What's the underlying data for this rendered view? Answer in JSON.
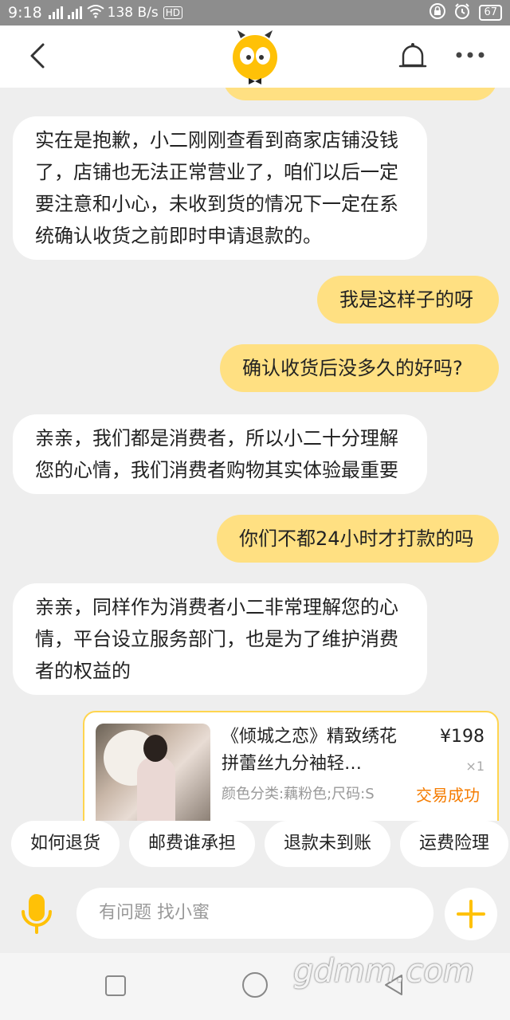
{
  "status_bar": {
    "time": "9:18",
    "net_type_1": "4G",
    "net_type_2": "2G",
    "speed": "138 B/s",
    "hd": "HD",
    "battery": "67"
  },
  "header": {
    "back_icon": "chevron-left-icon",
    "bell_icon": "bell-icon",
    "more_icon": "more-dots-icon",
    "brand_color": "#ffc107"
  },
  "messages": [
    {
      "side": "left",
      "text_lines": [
        "实在是抱歉，小二刚刚查看到商家店铺没钱",
        "了，店铺也无法正常营业了，咱们以后一定",
        "要注意和小心，未收到货的情况下一定在系",
        "统确认收货之前即时申请退款的。"
      ]
    },
    {
      "side": "right",
      "text_lines": [
        "我是这样子的呀"
      ]
    },
    {
      "side": "right",
      "text_lines": [
        "确认收货后没多久的好吗?"
      ]
    },
    {
      "side": "left",
      "text_lines": [
        "亲亲，我们都是消费者，所以小二十分理解",
        "您的心情，我们消费者购物其实体验最重要"
      ]
    },
    {
      "side": "right",
      "text_lines": [
        "你们不都24小时才打款的吗"
      ]
    },
    {
      "side": "left",
      "text_lines": [
        "亲亲，同样作为消费者小二非常理解您的心",
        "情，平台设立服务部门，也是为了维护消费",
        "者的权益的"
      ]
    }
  ],
  "product_card": {
    "title": "《倾城之恋》精致绣花拼蕾丝九分袖轻…",
    "spec": "颜色分类:藕粉色;尺码:S",
    "price": "¥198",
    "qty": "×1",
    "status": "交易成功",
    "status_color": "#f57c00"
  },
  "quick_replies": [
    "如何退货",
    "邮费谁承担",
    "退款未到账",
    "运费险理"
  ],
  "input": {
    "placeholder": "有问题 找小蜜",
    "mic_icon": "microphone-icon",
    "plus_icon": "plus-icon"
  },
  "nav": {
    "recents_icon": "square-icon",
    "home_icon": "circle-icon",
    "back_icon": "triangle-back-icon"
  },
  "watermark": "gdmm.com"
}
